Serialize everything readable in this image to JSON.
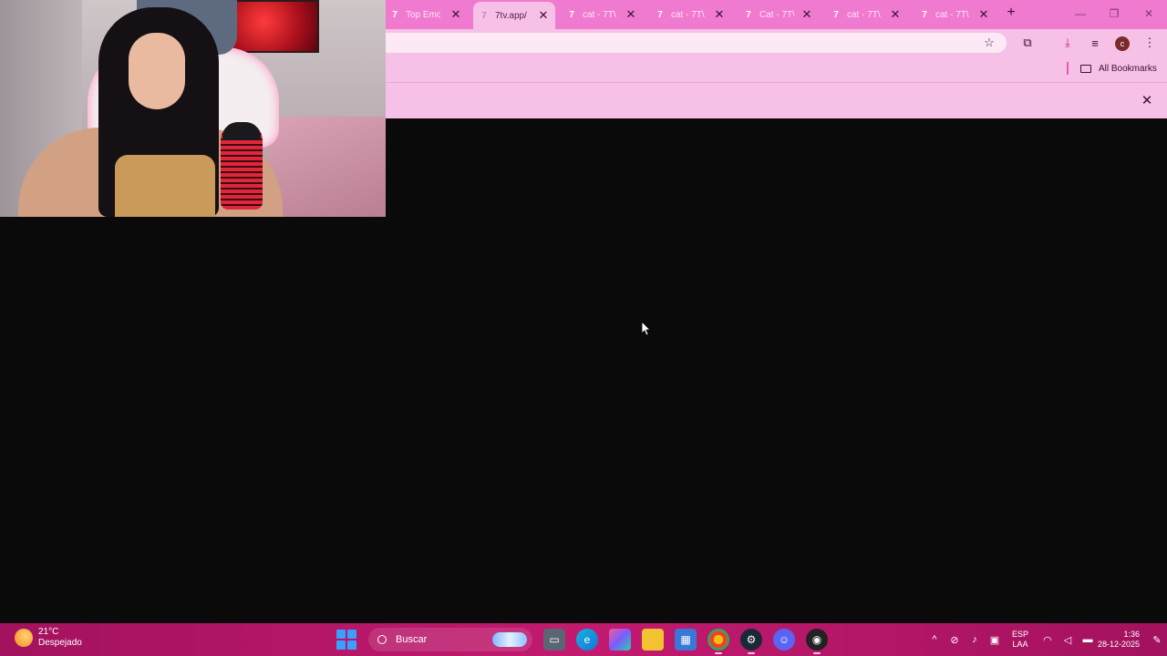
{
  "browser": {
    "tabs": [
      {
        "title": "Top Emo",
        "active": false
      },
      {
        "title": "7tv.app/",
        "active": true
      },
      {
        "title": "cat - 7T\\",
        "active": false
      },
      {
        "title": "cat - 7T\\",
        "active": false
      },
      {
        "title": "Cat - 7T\\",
        "active": false
      },
      {
        "title": "cat - 7T\\",
        "active": false
      },
      {
        "title": "cat - 7T\\",
        "active": false
      }
    ],
    "new_tab": "+",
    "bookmarks": {
      "all_label": "All Bookmarks"
    },
    "profile_initial": "c"
  },
  "taskbar": {
    "weather": {
      "temp": "21°C",
      "condition": "Despejado"
    },
    "search_placeholder": "Buscar",
    "language": {
      "line1": "ESP",
      "line2": "LAA"
    },
    "clock": {
      "time": "1:36",
      "date": "28-12-2025"
    }
  },
  "colors": {
    "tabstrip": "#f07ad0",
    "toolbar": "#f7c0e6",
    "taskbar": "#c21a6f",
    "page_bg": "#0a0a0b"
  }
}
